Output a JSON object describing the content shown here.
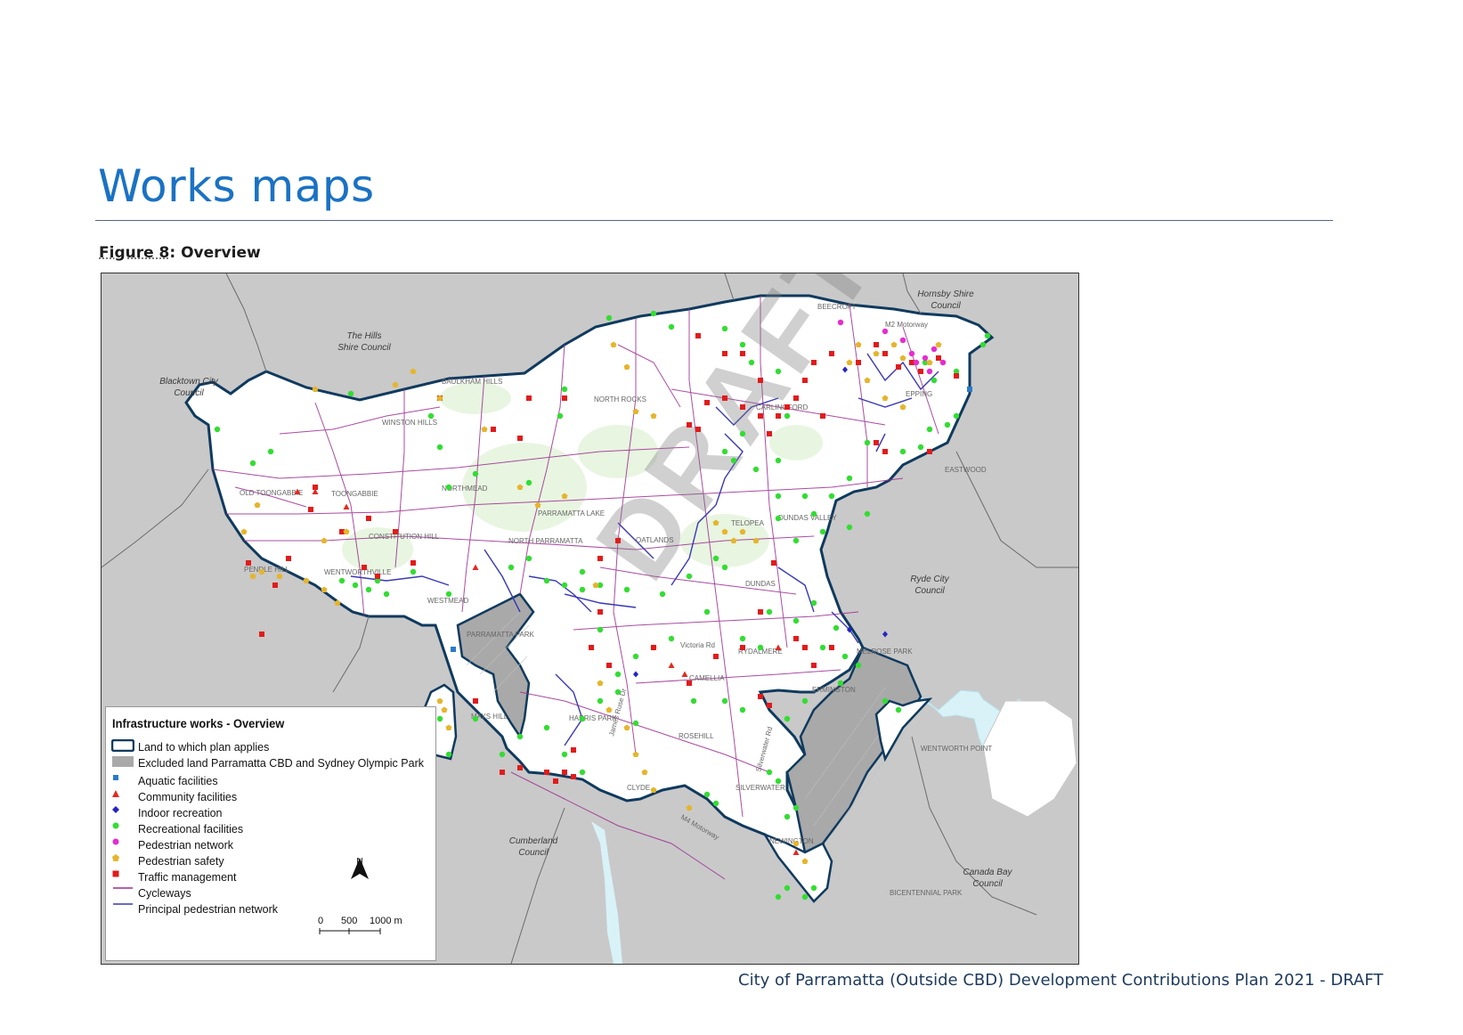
{
  "page": {
    "title": "Works maps",
    "figure_number": "Figure 8",
    "figure_title": ": Overview",
    "footer": "City of Parramatta (Outside CBD) Development Contributions Plan 2021 - DRAFT"
  },
  "map": {
    "watermark": "DRAFT",
    "colors": {
      "background_land": "#c9c9c9",
      "plan_area": "#ffffff",
      "plan_border": "#0f3a5e",
      "excluded": "#a9a9a9",
      "water": "#d8f2f8",
      "parkland": "#e6f5de",
      "cycleway": "#9b2d8f",
      "pedestrian_network": "#3838b5",
      "aquatic": "#2a7bc9",
      "community": "#e02b20",
      "indoor": "#2424c4",
      "recreational": "#33dd33",
      "pedestrian_network_point": "#e62ccf",
      "pedestrian_safety": "#e5b52c",
      "traffic": "#e21b1b"
    },
    "councils": [
      {
        "name1": "The Hills",
        "name2": "Shire Council"
      },
      {
        "name1": "Blacktown City",
        "name2": "Council"
      },
      {
        "name1": "Hornsby Shire",
        "name2": "Council"
      },
      {
        "name1": "Ryde City",
        "name2": "Council"
      },
      {
        "name1": "Cumberland",
        "name2": "Council"
      },
      {
        "name1": "Canada Bay",
        "name2": "Council"
      }
    ],
    "places": [
      "BAULKHAM HILLS",
      "WINSTON HILLS",
      "NORTH ROCKS",
      "CARLINGFORD",
      "BEECROFT",
      "EPPING",
      "EASTWOOD",
      "TOONGABBIE",
      "CONSTITUTION HILL",
      "PENDLE HILL",
      "WENTWORTHVILLE",
      "WESTMEAD",
      "NORTHMEAD",
      "NORTH PARRAMATTA",
      "OATLANDS",
      "TELOPEA",
      "DUNDAS VALLEY",
      "DUNDAS",
      "RYDALMERE",
      "MELROSE PARK",
      "ERMINGTON",
      "CAMELLIA",
      "ROSEHILL",
      "HARRIS PARK",
      "CLYDE",
      "SILVERWATER",
      "NEWINGTON",
      "WENTWORTH POINT",
      "PARRAMATTA PARK",
      "PARRAMATTA LAKE",
      "BICENTENNIAL PARK",
      "Victoria Rd",
      "M2 Motorway",
      "James Ruse Dr",
      "Silverwater Rd",
      "M4 Motorway",
      "OLD TOONGABBIE",
      "MAYS HILL"
    ]
  },
  "legend": {
    "title": "Infrastructure works - Overview",
    "items": [
      {
        "label": "Land to which plan applies",
        "symbol": "boundary"
      },
      {
        "label": "Excluded land Parramatta CBD and Sydney Olympic Park",
        "symbol": "excluded"
      },
      {
        "label": "Aquatic facilities",
        "symbol": "square-blue"
      },
      {
        "label": "Community facilities",
        "symbol": "triangle-red"
      },
      {
        "label": "Indoor recreation",
        "symbol": "diamond-blue"
      },
      {
        "label": "Recreational facilities",
        "symbol": "circle-green"
      },
      {
        "label": "Pedestrian network",
        "symbol": "circle-magenta"
      },
      {
        "label": "Pedestrian safety",
        "symbol": "pentagon-yellow"
      },
      {
        "label": "Traffic management",
        "symbol": "square-red"
      },
      {
        "label": "Cycleways",
        "symbol": "line-purple"
      },
      {
        "label": "Principal pedestrian network",
        "symbol": "line-blue"
      }
    ],
    "north": "N",
    "scale": {
      "s0": "0",
      "s1": "500",
      "s2": "1000 m"
    }
  }
}
